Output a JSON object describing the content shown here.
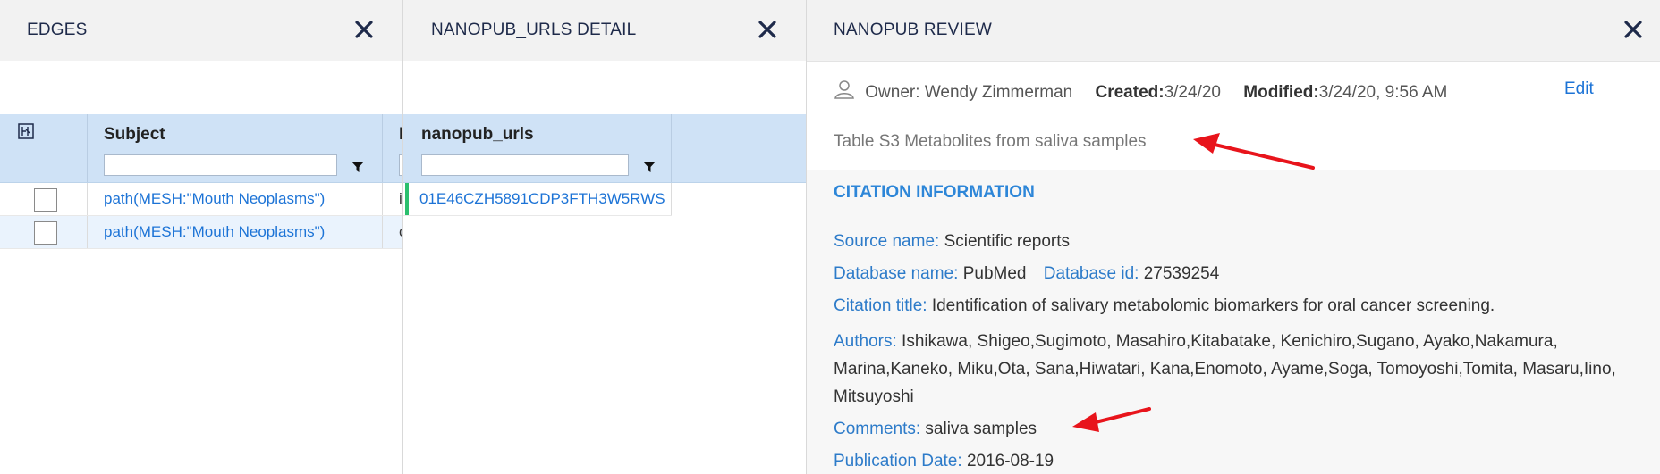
{
  "panels": {
    "edges": {
      "title": "EDGES",
      "columns": {
        "subject": "Subject",
        "relation_cut": "R"
      },
      "rows": [
        {
          "subject": "path(MESH:\"Mouth Neoplasms\")",
          "relation_cut": "i"
        },
        {
          "subject": "path(MESH:\"Mouth Neoplasms\")",
          "relation_cut": "c"
        }
      ]
    },
    "nanopub_urls_detail": {
      "title": "NANOPUB_URLS DETAIL",
      "column": "nanopub_urls",
      "rows": [
        {
          "value": "01E46CZH5891CDP3FTH3W5RWS"
        }
      ]
    },
    "review": {
      "title": "NANOPUB REVIEW",
      "owner_label": "Owner:",
      "owner": "Wendy Zimmerman",
      "created_label": "Created:",
      "created": "3/24/20",
      "modified_label": "Modified:",
      "modified": "3/24/20, 9:56 AM",
      "edit_label": "Edit",
      "description": "Table S3 Metabolites from saliva samples",
      "citation": {
        "section_title": "CITATION INFORMATION",
        "source_name_label": "Source name:",
        "source_name": "Scientific reports",
        "database_name_label": "Database name:",
        "database_name": "PubMed",
        "database_id_label": "Database id:",
        "database_id": "27539254",
        "citation_title_label": "Citation title:",
        "citation_title": "Identification of salivary metabolomic biomarkers for oral cancer screening.",
        "authors_label": "Authors:",
        "authors": "Ishikawa, Shigeo,Sugimoto, Masahiro,Kitabatake, Kenichiro,Sugano, Ayako,Nakamura, Marina,Kaneko, Miku,Ota, Sana,Hiwatari, Kana,Enomoto, Ayame,Soga, Tomoyoshi,Tomita, Masaru,Iino, Mitsuyoshi",
        "comments_label": "Comments:",
        "comments": "saliva samples",
        "publication_date_label": "Publication Date:",
        "publication_date": "2016-08-19"
      }
    }
  },
  "colors": {
    "accent": "#1c73d6",
    "header_bg": "#cfe2f6",
    "annotation_arrow": "#e8141b",
    "row_marker": "#2bbf6e"
  },
  "icons": [
    "close-icon",
    "column-chooser-icon",
    "filter-icon",
    "user-icon",
    "arrow-annotation"
  ]
}
